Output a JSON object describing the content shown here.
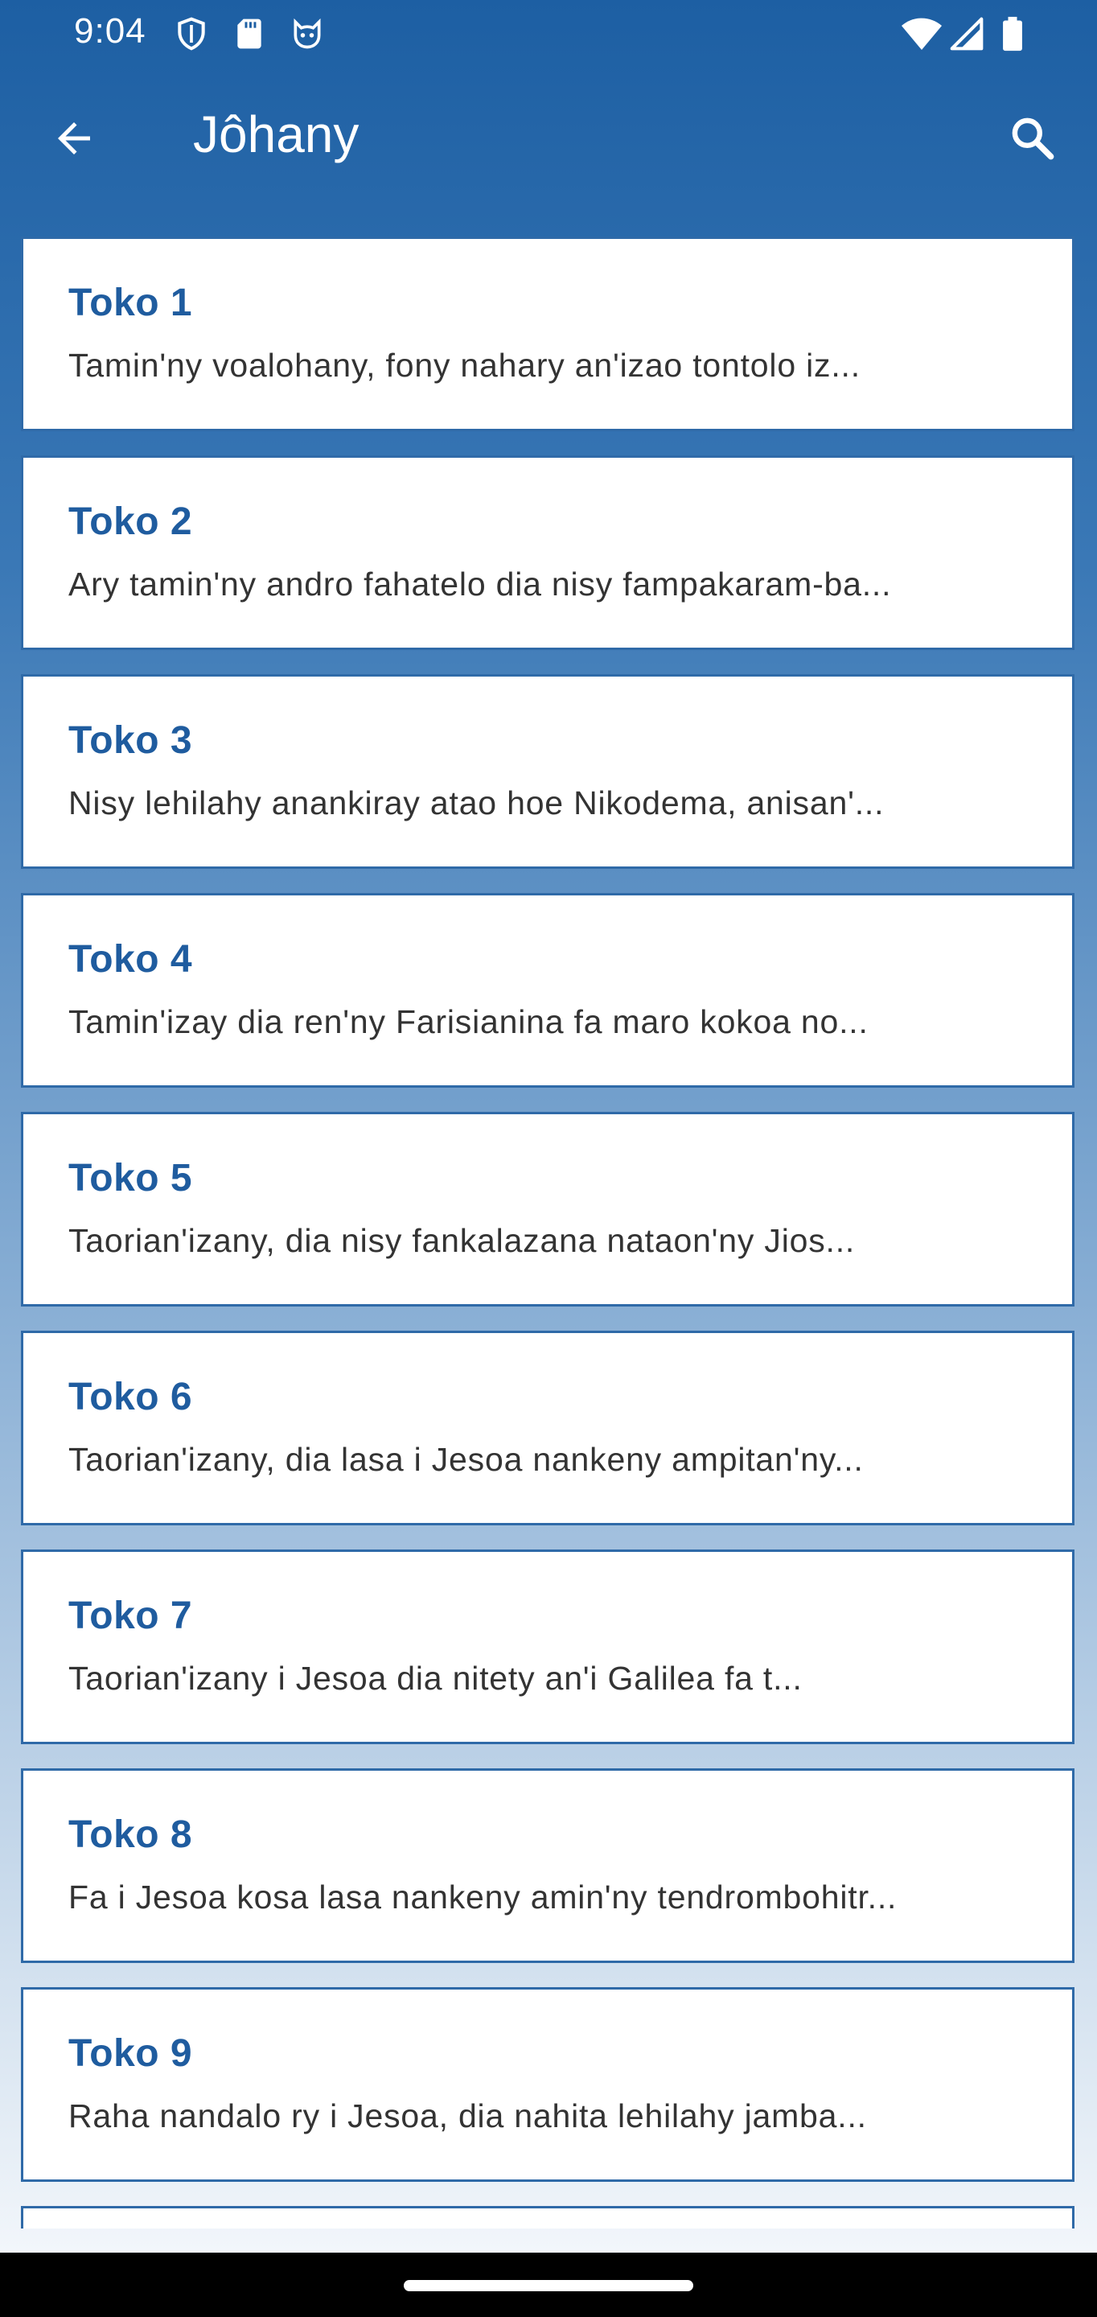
{
  "status_bar": {
    "time": "9:04",
    "icons": [
      "shield-icon",
      "sd-card-icon",
      "cat-face-icon",
      "wifi-icon",
      "signal-icon",
      "battery-icon"
    ]
  },
  "app_bar": {
    "title": "Jôhany",
    "back_icon": "arrow-back-icon",
    "search_icon": "search-icon"
  },
  "chapters": [
    {
      "title": "Toko 1",
      "preview": "Tamin'ny voalohany, fony nahary an'izao tontolo iz..."
    },
    {
      "title": "Toko 2",
      "preview": "Ary tamin'ny andro fahatelo dia nisy fampakaram-ba..."
    },
    {
      "title": "Toko 3",
      "preview": "Nisy lehilahy anankiray atao hoe Nikodema, anisan'..."
    },
    {
      "title": "Toko 4",
      "preview": "Tamin'izay dia ren'ny Farisianina fa maro kokoa no..."
    },
    {
      "title": "Toko 5",
      "preview": "Taorian'izany, dia nisy fankalazana nataon'ny Jios..."
    },
    {
      "title": "Toko 6",
      "preview": "Taorian'izany, dia lasa i Jesoa nankeny ampitan'ny..."
    },
    {
      "title": "Toko 7",
      "preview": "Taorian'izany i Jesoa dia nitety an'i Galilea fa t..."
    },
    {
      "title": "Toko 8",
      "preview": "Fa i Jesoa kosa lasa nankeny amin'ny tendrombohitr..."
    },
    {
      "title": "Toko 9",
      "preview": "Raha nandalo ry i Jesoa, dia nahita lehilahy jamba..."
    },
    {
      "title": "",
      "preview": ""
    }
  ],
  "colors": {
    "primary": "#1d5fa3",
    "card_border": "#2f6aa8",
    "card_title": "#1f5c9f"
  }
}
